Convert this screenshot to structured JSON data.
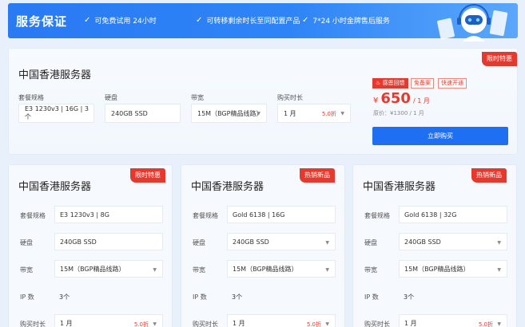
{
  "banner": {
    "title": "服务保证",
    "features": [
      {
        "icon": "check-icon",
        "text": "可免费试用 24小时"
      },
      {
        "icon": "check-icon",
        "text": "可转移剩余时长至同配置产品"
      },
      {
        "icon": "check-icon",
        "text": "7*24 小时金牌售后服务"
      }
    ],
    "mascot_icon": "support-robot-icon"
  },
  "featured": {
    "ribbon": "限时特惠",
    "title": "中国香港服务器",
    "fields": [
      {
        "label": "套餐规格",
        "value": "E3 1230v3 | 16G | 3个"
      },
      {
        "label": "硬盘",
        "value": "240GB SSD"
      },
      {
        "label": "带宽",
        "value": "15M（BGP精品线路）"
      },
      {
        "label": "购买时长",
        "value": "1 月",
        "hint": "5.0折"
      }
    ],
    "tags": [
      "感恩回馈",
      "免备案",
      "快速开通"
    ],
    "tag_icon": "fire-icon",
    "price": {
      "symbol": "¥",
      "amount": "650",
      "unit": "/ 1 月"
    },
    "original_price": "原价：¥1300 / 1 月",
    "buy_label": "立即购买"
  },
  "cards": [
    {
      "ribbon": "限时特惠",
      "title": "中国香港服务器",
      "spec_label": "套餐规格",
      "spec": "E3 1230v3 | 8G",
      "disk_label": "硬盘",
      "disk": "240GB SSD",
      "bandwidth_label": "带宽",
      "bandwidth": "15M（BGP精品线路）",
      "ip_label": "IP 数",
      "ip": "3个",
      "duration_label": "购买时长",
      "duration": "1 月",
      "hint": "5.0折"
    },
    {
      "ribbon": "热销新品",
      "title": "中国香港服务器",
      "spec_label": "套餐规格",
      "spec": "Gold 6138 | 16G",
      "disk_label": "硬盘",
      "disk": "240GB SSD",
      "bandwidth_label": "带宽",
      "bandwidth": "15M（BGP精品线路）",
      "ip_label": "IP 数",
      "ip": "3个",
      "duration_label": "购买时长",
      "duration": "1 月",
      "hint": "5.0折"
    },
    {
      "ribbon": "热销新品",
      "title": "中国香港服务器",
      "spec_label": "套餐规格",
      "spec": "Gold 6138 | 32G",
      "disk_label": "硬盘",
      "disk": "240GB SSD",
      "bandwidth_label": "带宽",
      "bandwidth": "15M（BGP精品线路）",
      "ip_label": "IP 数",
      "ip": "3个",
      "duration_label": "购买时长",
      "duration": "1 月",
      "hint": "5.0折"
    }
  ]
}
